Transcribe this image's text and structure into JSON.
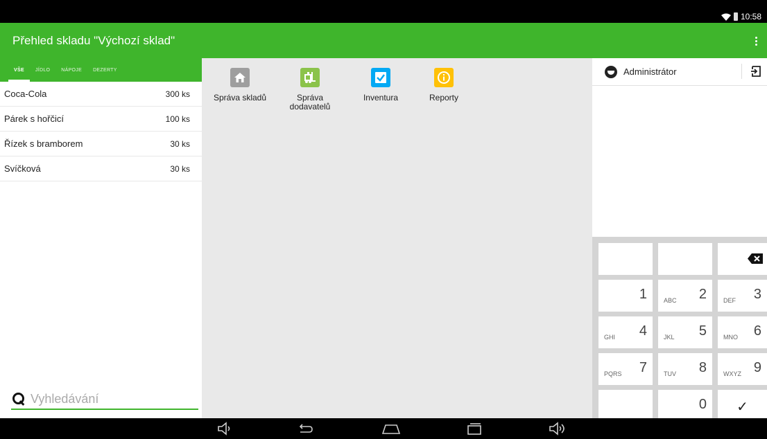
{
  "status_bar": {
    "time": "10:58"
  },
  "app_bar": {
    "title": "Přehled skladu \"Výchozí sklad\""
  },
  "categories": [
    {
      "label": "VŠE",
      "active": true
    },
    {
      "label": "JÍDLO",
      "active": false
    },
    {
      "label": "NÁPOJE",
      "active": false
    },
    {
      "label": "DEZERTY",
      "active": false
    }
  ],
  "stock_items": [
    {
      "name": "Coca-Cola",
      "qty": "300 ks"
    },
    {
      "name": "Párek s hořčicí",
      "qty": "100 ks"
    },
    {
      "name": "Řízek s bramborem",
      "qty": "30 ks"
    },
    {
      "name": "Svíčková",
      "qty": "30 ks"
    }
  ],
  "search": {
    "placeholder": "Vyhledávání",
    "value": ""
  },
  "tiles": [
    {
      "label": "Správa skladů",
      "icon": "home-icon",
      "color": "#9e9e9e"
    },
    {
      "label": "Správa dodavatelů",
      "icon": "forklift-icon",
      "color": "#8bc34a"
    },
    {
      "label": "Inventura",
      "icon": "checkbox-icon",
      "color": "#03a9f4"
    },
    {
      "label": "Reporty",
      "icon": "info-icon",
      "color": "#ffc107"
    }
  ],
  "user": {
    "name": "Administrátor"
  },
  "keypad": [
    {
      "digit": "",
      "letters": ""
    },
    {
      "digit": "",
      "letters": ""
    },
    {
      "digit": "",
      "letters": "",
      "symbol": "backspace-icon"
    },
    {
      "digit": "1",
      "letters": ""
    },
    {
      "digit": "2",
      "letters": "ABC"
    },
    {
      "digit": "3",
      "letters": "DEF"
    },
    {
      "digit": "4",
      "letters": "GHI"
    },
    {
      "digit": "5",
      "letters": "JKL"
    },
    {
      "digit": "6",
      "letters": "MNO"
    },
    {
      "digit": "7",
      "letters": "PQRS"
    },
    {
      "digit": "8",
      "letters": "TUV"
    },
    {
      "digit": "9",
      "letters": "WXYZ"
    },
    {
      "digit": "",
      "letters": ""
    },
    {
      "digit": "0",
      "letters": ""
    },
    {
      "digit": "",
      "letters": "",
      "symbol": "✓"
    }
  ],
  "colors": {
    "accent": "#3fb52c"
  }
}
